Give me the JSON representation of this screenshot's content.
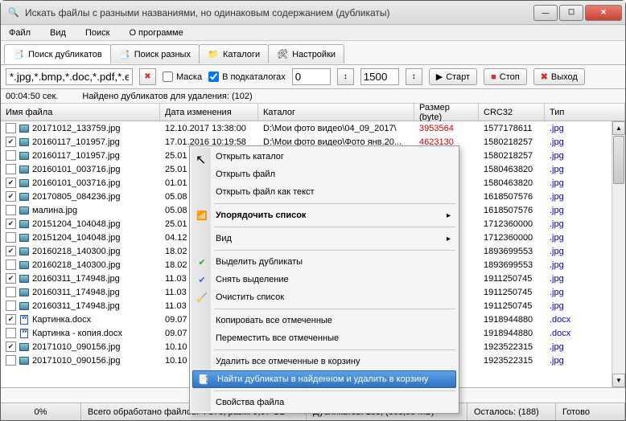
{
  "title": "Искать файлы с разными названиями, но одинаковым содержанием (дубликаты)",
  "menu": {
    "file": "Файл",
    "view": "Вид",
    "search": "Поиск",
    "about": "О программе"
  },
  "tabs": {
    "dup": "Поиск дубликатов",
    "diff": "Поиск разных",
    "catalogs": "Каталоги",
    "settings": "Настройки"
  },
  "filter": {
    "pattern_value": "*.jpg,*.bmp,*.doc,*.pdf,*.exe",
    "mask": "Маска",
    "subfolders": "В подкаталогах",
    "n1": "0",
    "n2": "1500",
    "start": "Старт",
    "stop": "Стоп",
    "exit": "Выход"
  },
  "info": {
    "timer": "00:04:50 сек.",
    "found": "Найдено дубликатов для удаления: (102)"
  },
  "columns": {
    "name": "Имя файла",
    "date": "Дата изменения",
    "cat": "Каталог",
    "size": "Размер (byte)",
    "crc": "CRC32",
    "type": "Тип"
  },
  "rows": [
    {
      "chk": false,
      "kind": "img",
      "name": "20171012_133759.jpg",
      "date": "12.10.2017 13:38:00",
      "cat": "D:\\Мои фото видео\\04_09_2017\\",
      "size": "3953564",
      "size_red": true,
      "crc": "1577178611",
      "type": ".jpg"
    },
    {
      "chk": true,
      "kind": "img",
      "name": "20160117_101957.jpg",
      "date": "17.01.2016 10:19:58",
      "cat": "D:\\Мои фото видео\\Фото янв.20...",
      "size": "4623130",
      "size_red": true,
      "crc": "1580218257",
      "type": ".jpg"
    },
    {
      "chk": false,
      "kind": "img",
      "name": "20160117_101957.jpg",
      "date": "25.01",
      "cat": "",
      "size": "",
      "size_red": false,
      "crc": "1580218257",
      "type": ".jpg"
    },
    {
      "chk": false,
      "kind": "img",
      "name": "20160101_003716.jpg",
      "date": "25.01",
      "cat": "",
      "size": "",
      "size_red": false,
      "crc": "1580463820",
      "type": ".jpg"
    },
    {
      "chk": true,
      "kind": "img",
      "name": "20160101_003716.jpg",
      "date": "01.01",
      "cat": "",
      "size": "",
      "size_red": false,
      "crc": "1580463820",
      "type": ".jpg"
    },
    {
      "chk": true,
      "kind": "img",
      "name": "20170805_084236.jpg",
      "date": "05.08",
      "cat": "",
      "size": "",
      "size_red": false,
      "crc": "1618507576",
      "type": ".jpg"
    },
    {
      "chk": false,
      "kind": "img",
      "name": "малина.jpg",
      "date": "05.08",
      "cat": "",
      "size": "",
      "size_red": false,
      "crc": "1618507576",
      "type": ".jpg"
    },
    {
      "chk": true,
      "kind": "img",
      "name": "20151204_104048.jpg",
      "date": "25.01",
      "cat": "",
      "size": "",
      "size_red": false,
      "crc": "1712360000",
      "type": ".jpg"
    },
    {
      "chk": false,
      "kind": "img",
      "name": "20151204_104048.jpg",
      "date": "04.12",
      "cat": "",
      "size": "",
      "size_red": false,
      "crc": "1712360000",
      "type": ".jpg"
    },
    {
      "chk": true,
      "kind": "img",
      "name": "20160218_140300.jpg",
      "date": "18.02",
      "cat": "",
      "size": "",
      "size_red": false,
      "crc": "1893699553",
      "type": ".jpg"
    },
    {
      "chk": false,
      "kind": "img",
      "name": "20160218_140300.jpg",
      "date": "18.02",
      "cat": "",
      "size": "",
      "size_red": false,
      "crc": "1893699553",
      "type": ".jpg"
    },
    {
      "chk": true,
      "kind": "img",
      "name": "20160311_174948.jpg",
      "date": "11.03",
      "cat": "",
      "size": "",
      "size_red": false,
      "crc": "1911250745",
      "type": ".jpg"
    },
    {
      "chk": false,
      "kind": "img",
      "name": "20160311_174948.jpg",
      "date": "11.03",
      "cat": "",
      "size": "",
      "size_red": false,
      "crc": "1911250745",
      "type": ".jpg"
    },
    {
      "chk": false,
      "kind": "img",
      "name": "20160311_174948.jpg",
      "date": "11.03",
      "cat": "",
      "size": "",
      "size_red": false,
      "crc": "1911250745",
      "type": ".jpg"
    },
    {
      "chk": true,
      "kind": "doc",
      "name": "Картинка.docx",
      "date": "09.07",
      "cat": "",
      "size": "",
      "size_red": false,
      "crc": "1918944880",
      "type": ".docx"
    },
    {
      "chk": false,
      "kind": "doc",
      "name": "Картинка - копия.docx",
      "date": "09.07",
      "cat": "",
      "size": "",
      "size_red": false,
      "crc": "1918944880",
      "type": ".docx"
    },
    {
      "chk": true,
      "kind": "img",
      "name": "20171010_090156.jpg",
      "date": "10.10",
      "cat": "",
      "size": "",
      "size_red": false,
      "crc": "1923522315",
      "type": ".jpg"
    },
    {
      "chk": false,
      "kind": "img",
      "name": "20171010_090156.jpg",
      "date": "10.10",
      "cat": "",
      "size": "",
      "size_red": false,
      "crc": "1923522315",
      "type": ".jpg"
    }
  ],
  "ctx": {
    "open_cat": "Открыть каталог",
    "open_file": "Открыть файл",
    "open_text": "Открыть файл как текст",
    "order": "Упорядочить список",
    "view": "Вид",
    "select_dup": "Выделить дубликаты",
    "deselect": "Снять выделение",
    "clear": "Очистить список",
    "copy_marked": "Копировать все отмеченные",
    "move_marked": "Переместить все отмеченные",
    "delete_marked": "Удалить все отмеченные в корзину",
    "find_delete": "Найти дубликаты в найденном и удалить в корзину",
    "props": "Свойства файла"
  },
  "status": {
    "pct": "0%",
    "processed": "Всего обработано файлов: 4 376, разм. 9,07 GB",
    "dup": "Дубликатов: 188,  (863,55 MB)",
    "left": "Осталось: (188)",
    "ready": "Готово"
  }
}
